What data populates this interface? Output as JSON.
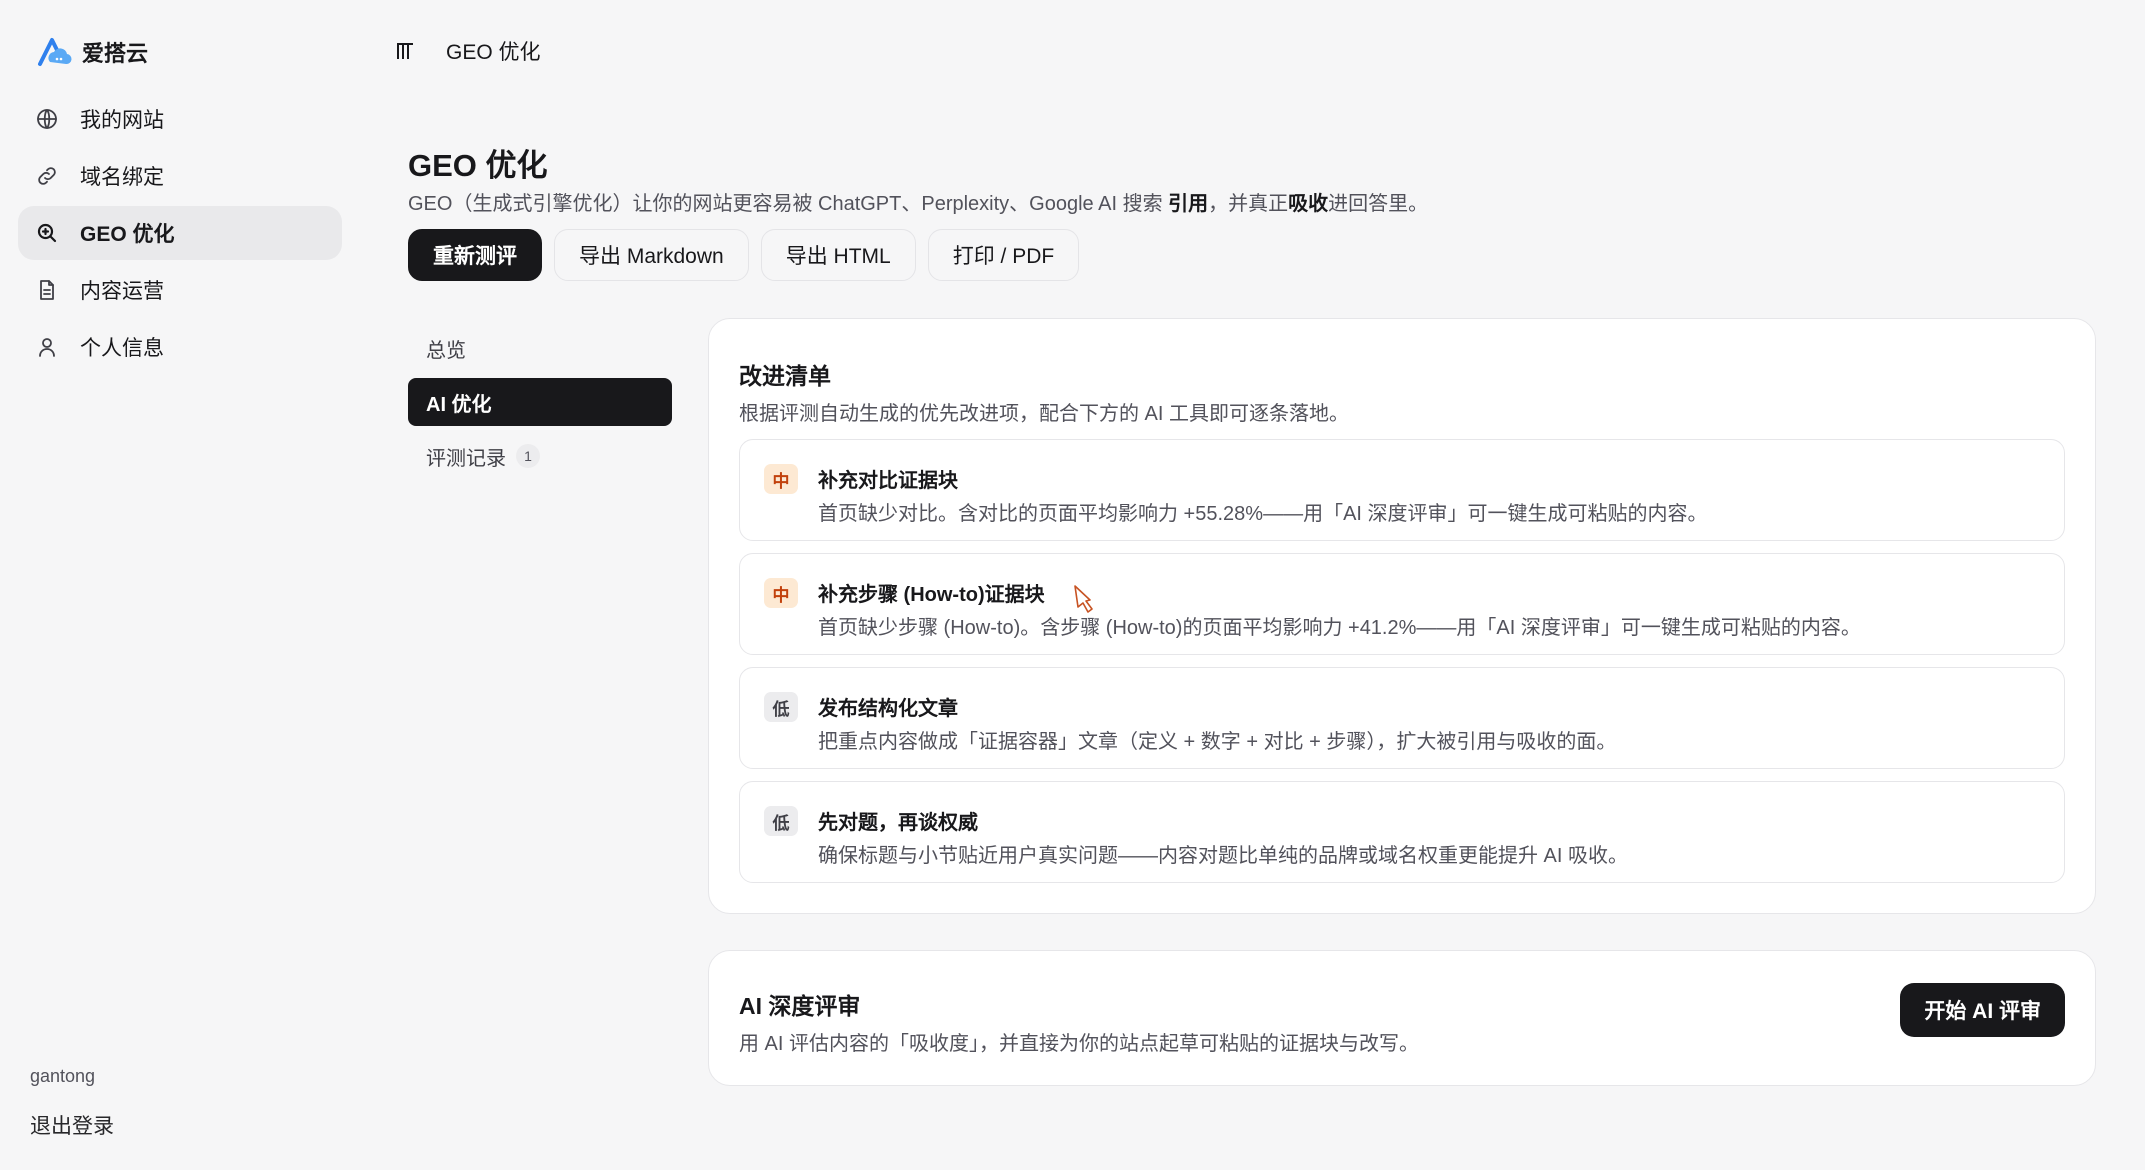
{
  "brand": {
    "name": "爱搭云",
    "accent": "#2f80ed"
  },
  "sidebar": {
    "items": [
      {
        "label": "我的网站",
        "icon": "globe-icon"
      },
      {
        "label": "域名绑定",
        "icon": "link-icon"
      },
      {
        "label": "GEO 优化",
        "icon": "search-zoom-icon",
        "active": true
      },
      {
        "label": "内容运营",
        "icon": "document-icon"
      },
      {
        "label": "个人信息",
        "icon": "user-icon"
      }
    ],
    "username": "gantong",
    "logout_label": "退出登录"
  },
  "topbar": {
    "title": "GEO 优化",
    "toggle_icon": "sidebar-toggle-icon"
  },
  "page": {
    "title": "GEO 优化",
    "desc_before": "GEO（生成式引擎优化）让你的网站更容易被 ChatGPT、Perplexity、Google AI 搜索 ",
    "desc_bold1": "引用",
    "desc_mid": "，并真正",
    "desc_bold2": "吸收",
    "desc_after": "进回答里。"
  },
  "actions": {
    "retest": "重新测评",
    "export_md": "导出 Markdown",
    "export_html": "导出 HTML",
    "print_pdf": "打印 / PDF"
  },
  "subnav": {
    "overview": "总览",
    "ai_opt": "AI 优化",
    "records": "评测记录",
    "records_count": "1"
  },
  "improve": {
    "title": "改进清单",
    "subtitle": "根据评测自动生成的优先改进项，配合下方的 AI 工具即可逐条落地。",
    "items": [
      {
        "priority": "中",
        "level": "mid",
        "title": "补充对比证据块",
        "desc": "首页缺少对比。含对比的页面平均影响力 +55.28%——用「AI 深度评审」可一键生成可粘贴的内容。"
      },
      {
        "priority": "中",
        "level": "mid",
        "title": "补充步骤 (How-to)证据块",
        "desc": "首页缺少步骤 (How-to)。含步骤 (How-to)的页面平均影响力 +41.2%——用「AI 深度评审」可一键生成可粘贴的内容。"
      },
      {
        "priority": "低",
        "level": "low",
        "title": "发布结构化文章",
        "desc": "把重点内容做成「证据容器」文章（定义 + 数字 + 对比 + 步骤），扩大被引用与吸收的面。"
      },
      {
        "priority": "低",
        "level": "low",
        "title": "先对题，再谈权威",
        "desc": "确保标题与小节贴近用户真实问题——内容对题比单纯的品牌或域名权重更能提升 AI 吸收。"
      }
    ]
  },
  "ai_review": {
    "title": "AI 深度评审",
    "subtitle": "用 AI 评估内容的「吸收度」，并直接为你的站点起草可粘贴的证据块与改写。",
    "button": "开始 AI 评审"
  }
}
